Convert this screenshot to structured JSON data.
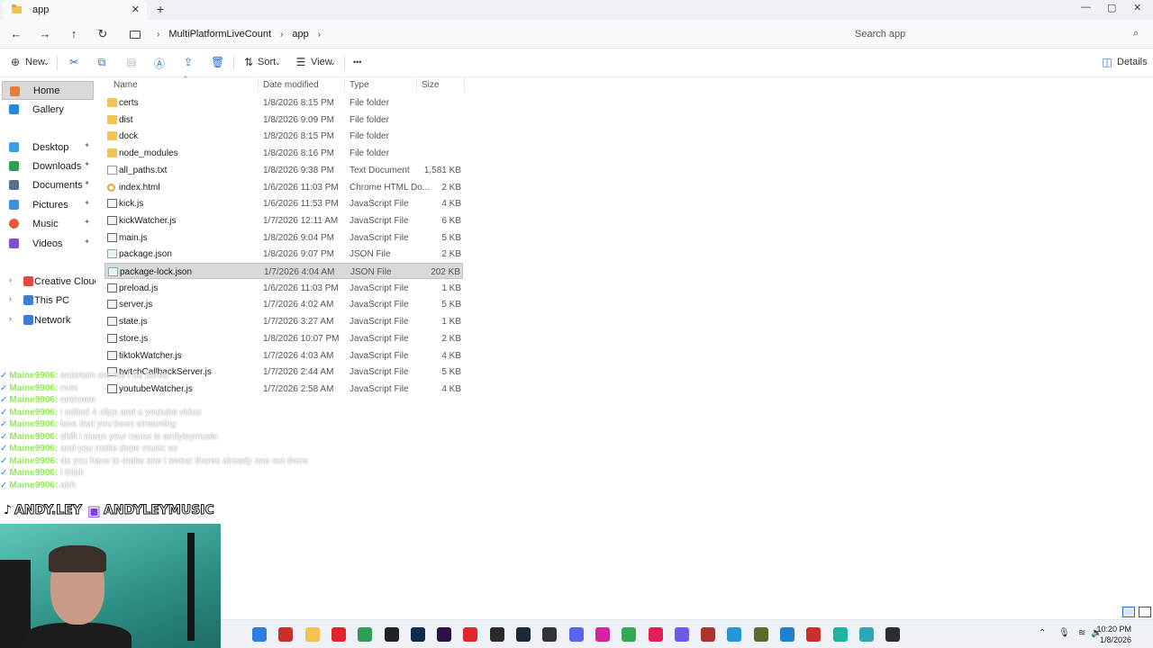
{
  "window": {
    "tab_title": "app",
    "tab_close": "✕",
    "new_tab": "+",
    "controls": {
      "minimize": "—",
      "maximize": "▢",
      "close": "✕"
    }
  },
  "address": {
    "nav": {
      "back": "←",
      "forward": "→",
      "up": "↑",
      "refresh": "↻"
    },
    "crumbs": [
      "MultiPlatformLiveCount",
      "app"
    ],
    "crumb_sep": "›",
    "search_placeholder": "Search app",
    "search_icon": "⌕"
  },
  "commands": {
    "new": "New",
    "sort": "Sort",
    "view": "View",
    "more": "•••",
    "details": "Details"
  },
  "sidebar": {
    "items": [
      {
        "label": "Home",
        "icon": "home-icon",
        "color": "#e27f3c"
      },
      {
        "label": "Gallery",
        "icon": "gallery-icon",
        "color": "#2a86d9"
      },
      {
        "label": "Desktop",
        "icon": "desktop-icon",
        "color": "#3ea0e0"
      },
      {
        "label": "Downloads",
        "icon": "downloads-icon",
        "color": "#2f9d55"
      },
      {
        "label": "Documents",
        "icon": "documents-icon",
        "color": "#5a6f8c"
      },
      {
        "label": "Pictures",
        "icon": "pictures-icon",
        "color": "#3f8ed8"
      },
      {
        "label": "Music",
        "icon": "music-icon",
        "color": "#e85a3c"
      },
      {
        "label": "Videos",
        "icon": "videos-icon",
        "color": "#7b4fd6"
      },
      {
        "label": "Creative Cloud Files",
        "icon": "creative-cloud-icon",
        "color": "#e24a3b"
      },
      {
        "label": "This PC",
        "icon": "this-pc-icon",
        "color": "#3a7fd0"
      },
      {
        "label": "Network",
        "icon": "network-icon",
        "color": "#3a7fd0"
      }
    ],
    "pin_glyph": "📌",
    "expand_glyph": "›"
  },
  "columns": {
    "name": "Name",
    "date": "Date modified",
    "type": "Type",
    "size": "Size"
  },
  "files": [
    {
      "name": "certs",
      "date": "1/8/2026 8:15 PM",
      "type": "File folder",
      "size": "",
      "kind": "folder"
    },
    {
      "name": "dist",
      "date": "1/8/2026 9:09 PM",
      "type": "File folder",
      "size": "",
      "kind": "folder"
    },
    {
      "name": "dock",
      "date": "1/8/2026 8:15 PM",
      "type": "File folder",
      "size": "",
      "kind": "folder"
    },
    {
      "name": "node_modules",
      "date": "1/8/2026 8:16 PM",
      "type": "File folder",
      "size": "",
      "kind": "folder"
    },
    {
      "name": "all_paths.txt",
      "date": "1/8/2026 9:38 PM",
      "type": "Text Document",
      "size": "1,581 KB",
      "kind": "doc"
    },
    {
      "name": "index.html",
      "date": "1/6/2026 11:03 PM",
      "type": "Chrome HTML Do...",
      "size": "2 KB",
      "kind": "html"
    },
    {
      "name": "kick.js",
      "date": "1/6/2026 11:53 PM",
      "type": "JavaScript File",
      "size": "4 KB",
      "kind": "js"
    },
    {
      "name": "kickWatcher.js",
      "date": "1/7/2026 12:11 AM",
      "type": "JavaScript File",
      "size": "6 KB",
      "kind": "js"
    },
    {
      "name": "main.js",
      "date": "1/8/2026 9:04 PM",
      "type": "JavaScript File",
      "size": "5 KB",
      "kind": "js"
    },
    {
      "name": "package.json",
      "date": "1/8/2026 9:07 PM",
      "type": "JSON File",
      "size": "2 KB",
      "kind": "json"
    },
    {
      "name": "package-lock.json",
      "date": "1/7/2026 4:04 AM",
      "type": "JSON File",
      "size": "202 KB",
      "kind": "json",
      "selected": true
    },
    {
      "name": "preload.js",
      "date": "1/6/2026 11:03 PM",
      "type": "JavaScript File",
      "size": "1 KB",
      "kind": "js"
    },
    {
      "name": "server.js",
      "date": "1/7/2026 4:02 AM",
      "type": "JavaScript File",
      "size": "5 KB",
      "kind": "js"
    },
    {
      "name": "state.js",
      "date": "1/7/2026 3:27 AM",
      "type": "JavaScript File",
      "size": "1 KB",
      "kind": "js"
    },
    {
      "name": "store.js",
      "date": "1/8/2026 10:07 PM",
      "type": "JavaScript File",
      "size": "2 KB",
      "kind": "js"
    },
    {
      "name": "tiktokWatcher.js",
      "date": "1/7/2026 4:03 AM",
      "type": "JavaScript File",
      "size": "4 KB",
      "kind": "js"
    },
    {
      "name": "twitchCallbackServer.js",
      "date": "1/7/2026 2:44 AM",
      "type": "JavaScript File",
      "size": "5 KB",
      "kind": "js"
    },
    {
      "name": "youtubeWatcher.js",
      "date": "1/7/2026 2:58 AM",
      "type": "JavaScript File",
      "size": "4 KB",
      "kind": "js"
    }
  ],
  "chat": {
    "badge": "✓",
    "user": "Maine9906:",
    "messages": [
      "entertain me me i be bored",
      "nvm",
      "nmmmm",
      "i edited 4 clips and a youtube video",
      "love that you been streaming",
      "shift i mean your name is andyleymusic",
      "and you make dope music so",
      "do you have to make one i swear theres already one out there",
      "i think",
      "ahh"
    ]
  },
  "socials": {
    "tiktok_glyph": "♪",
    "tiktok": "ANDY.LEY",
    "twitch_glyph": "▣",
    "twitch": "ANDYLEYMUSIC"
  },
  "taskbar": {
    "apps": [
      {
        "name": "windows-start-icon",
        "color": "#2f7de1"
      },
      {
        "name": "widgets-icon",
        "color": "#c9302c"
      },
      {
        "name": "file-explorer-icon",
        "color": "#f2c14e"
      },
      {
        "name": "opera-icon",
        "color": "#e0262d"
      },
      {
        "name": "xbox-icon",
        "color": "#2f9d55"
      },
      {
        "name": "capcut-icon",
        "color": "#222222"
      },
      {
        "name": "photoshop-icon",
        "color": "#0f2a4a"
      },
      {
        "name": "premiere-icon",
        "color": "#2a0f4a"
      },
      {
        "name": "record-icon",
        "color": "#e0262d"
      },
      {
        "name": "epic-games-icon",
        "color": "#2b2b2b"
      },
      {
        "name": "steam-icon",
        "color": "#1b2838"
      },
      {
        "name": "obs-icon",
        "color": "#333333"
      },
      {
        "name": "discord-icon",
        "color": "#5865f2"
      },
      {
        "name": "instagram-icon",
        "color": "#d6249f"
      },
      {
        "name": "chrome-icon",
        "color": "#34a853"
      },
      {
        "name": "tiktok-icon",
        "color": "#e01e5a"
      },
      {
        "name": "copilot-icon",
        "color": "#6b5ce7"
      },
      {
        "name": "app-red-icon",
        "color": "#b0322c"
      },
      {
        "name": "edge-icon",
        "color": "#1f9ad6"
      },
      {
        "name": "notes-icon",
        "color": "#5a6b2c"
      },
      {
        "name": "photos-icon",
        "color": "#1f7fd1"
      },
      {
        "name": "app-red2-icon",
        "color": "#c9302c"
      },
      {
        "name": "edge2-icon",
        "color": "#1fb3a0"
      },
      {
        "name": "notepad-icon",
        "color": "#2aa8b8"
      },
      {
        "name": "davinci-icon",
        "color": "#2d2d2d"
      }
    ],
    "tray": {
      "chevron": "⌃",
      "mic": "🎙",
      "wifi": "≋",
      "volume": "🔊",
      "battery": "▭"
    },
    "time": "10:20 PM",
    "date": "1/8/2026"
  }
}
